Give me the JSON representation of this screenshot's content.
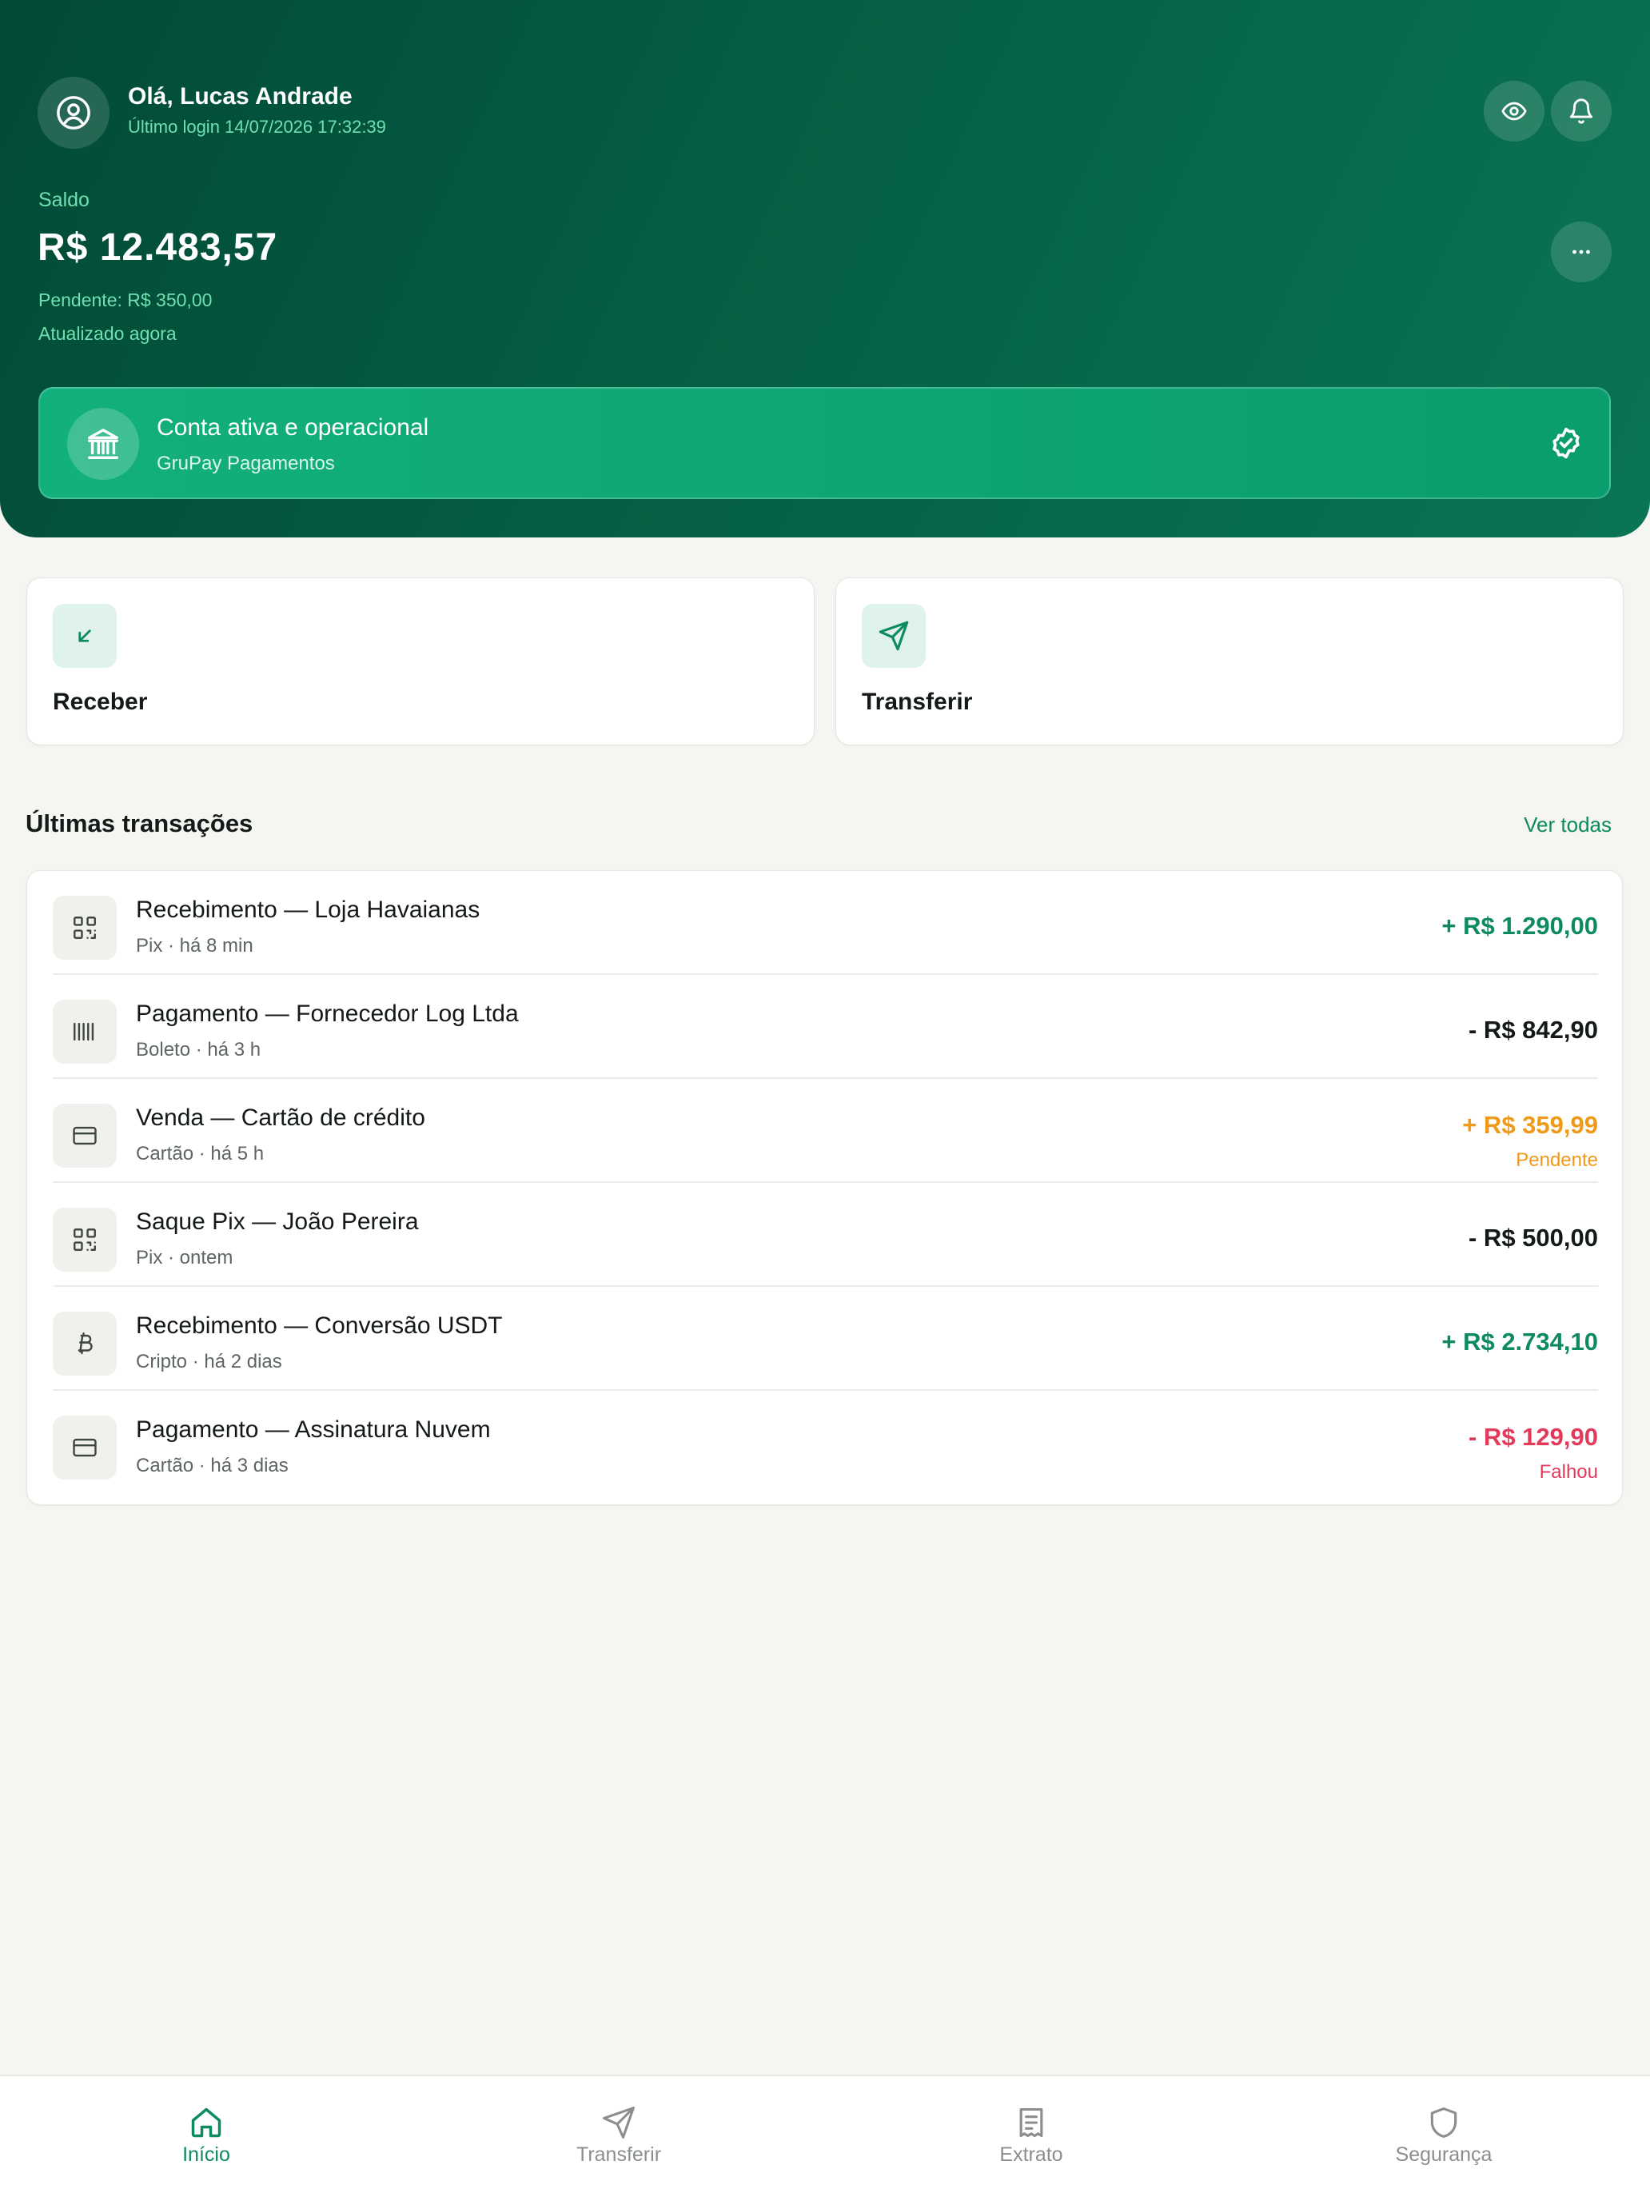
{
  "colors": {
    "brand_dark": "#024a36",
    "accent": "#0d8a5e",
    "positive": "#0d8a5e",
    "pending": "#f09a1a",
    "failed": "#e23a5a"
  },
  "header": {
    "greeting": "Olá, Lucas Andrade",
    "last_login": "Último login 14/07/2026 17:32:39",
    "balance_label": "Saldo",
    "balance_value": "R$ 12.483,57",
    "pending": "Pendente: R$ 350,00",
    "updated": "Atualizado agora",
    "icons": [
      "user-circle-icon",
      "eye-icon",
      "bell-icon",
      "more-icon"
    ]
  },
  "account_status": {
    "title": "Conta ativa e operacional",
    "subtitle": "GruPay Pagamentos",
    "icons": [
      "bank-icon",
      "verified-badge-icon"
    ]
  },
  "actions": [
    {
      "label": "Receber",
      "icon": "arrow-down-left-icon"
    },
    {
      "label": "Transferir",
      "icon": "send-icon"
    }
  ],
  "transactions": {
    "title": "Últimas transações",
    "see_all": "Ver todas",
    "items": [
      {
        "title": "Recebimento — Loja Havaianas",
        "sub": "Pix · há 8 min",
        "amount": "+ R$ 1.290,00",
        "status": "",
        "tone": "positive",
        "icon": "qr-code-icon"
      },
      {
        "title": "Pagamento — Fornecedor Log Ltda",
        "sub": "Boleto · há 3 h",
        "amount": "- R$ 842,90",
        "status": "",
        "tone": "neutral",
        "icon": "barcode-icon"
      },
      {
        "title": "Venda — Cartão de crédito",
        "sub": "Cartão · há 5 h",
        "amount": "+ R$ 359,99",
        "status": "Pendente",
        "tone": "pending",
        "icon": "credit-card-icon"
      },
      {
        "title": "Saque Pix — João Pereira",
        "sub": "Pix · ontem",
        "amount": "- R$ 500,00",
        "status": "",
        "tone": "neutral",
        "icon": "qr-code-icon"
      },
      {
        "title": "Recebimento — Conversão USDT",
        "sub": "Cripto · há 2 dias",
        "amount": "+ R$ 2.734,10",
        "status": "",
        "tone": "positive",
        "icon": "bitcoin-icon"
      },
      {
        "title": "Pagamento — Assinatura Nuvem",
        "sub": "Cartão · há 3 dias",
        "amount": "- R$ 129,90",
        "status": "Falhou",
        "tone": "failed",
        "icon": "credit-card-icon"
      }
    ]
  },
  "nav": {
    "items": [
      {
        "label": "Início",
        "icon": "home-icon",
        "active": true
      },
      {
        "label": "Transferir",
        "icon": "send-icon",
        "active": false
      },
      {
        "label": "Extrato",
        "icon": "receipt-icon",
        "active": false
      },
      {
        "label": "Segurança",
        "icon": "shield-icon",
        "active": false
      }
    ]
  }
}
